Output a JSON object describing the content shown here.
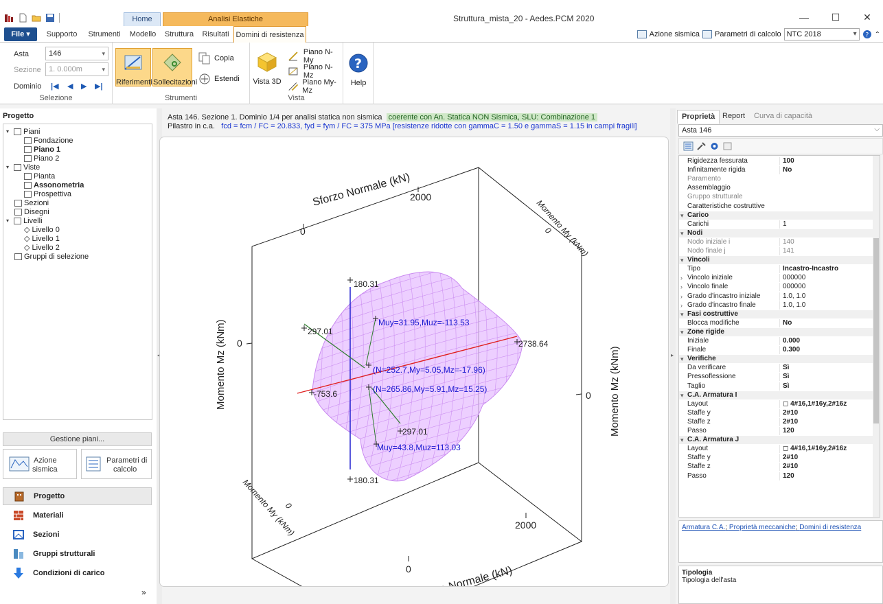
{
  "window": {
    "title": "Struttura_mista_20 - Aedes.PCM 2020",
    "context_home": "Home",
    "context_group": "Analisi Elastiche",
    "minimize": "—",
    "maximize": "☐",
    "close": "✕"
  },
  "tabs": {
    "file": "File ▾",
    "supporto": "Supporto",
    "strumenti": "Strumenti",
    "modello": "Modello",
    "struttura": "Struttura",
    "risultati": "Risultati",
    "domini": "Domini di resistenza"
  },
  "top_right": {
    "azione_sismica": "Azione sismica",
    "parametri_calcolo": "Parametri di calcolo",
    "norma": "NTC 2018"
  },
  "ribbon": {
    "selezione": {
      "label": "Selezione",
      "asta_label": "Asta",
      "asta_value": "146",
      "sezione_label": "Sezione",
      "sezione_value": "1. 0.000m",
      "dominio_label": "Dominio",
      "nav_first": "|◀",
      "nav_prev": "◀",
      "nav_next": "▶",
      "nav_last": "▶|"
    },
    "strumenti": {
      "label": "Strumenti",
      "riferimenti": "Riferimenti",
      "sollecitazioni": "Sollecitazioni",
      "copia": "Copia",
      "estendi": "Estendi"
    },
    "vista": {
      "label": "Vista",
      "vista3d": "Vista 3D",
      "piano_nmy": "Piano N-My",
      "piano_nmz": "Piano N-Mz",
      "piano_mymz": "Piano My-Mz"
    },
    "help": "Help"
  },
  "left": {
    "title": "Progetto",
    "tree": {
      "piani": "Piani",
      "fondazione": "Fondazione",
      "piano1": "Piano 1",
      "piano2": "Piano 2",
      "viste": "Viste",
      "pianta": "Pianta",
      "assonometria": "Assonometria",
      "prospettiva": "Prospettiva",
      "sezioni": "Sezioni",
      "disegni": "Disegni",
      "livelli": "Livelli",
      "livello0": "Livello 0",
      "livello1": "Livello 1",
      "livello2": "Livello 2",
      "gruppi": "Gruppi di selezione"
    },
    "gestione_piani": "Gestione piani...",
    "btn_azione_1": "Azione",
    "btn_azione_2": "sismica",
    "btn_param_1": "Parametri di",
    "btn_param_2": "calcolo",
    "nav": {
      "progetto": "Progetto",
      "materiali": "Materiali",
      "sezioni": "Sezioni",
      "gruppi": "Gruppi strutturali",
      "condizioni": "Condizioni di carico"
    },
    "more": "»"
  },
  "center": {
    "header1": "Asta 146. Sezione 1. Dominio 1/4 per analisi statica non sismica",
    "header1_badge": "coerente con An. Statica NON Sismica, SLU: Combinazione 1",
    "header2_label": "Pilastro in c.a.",
    "header2_values": "fcd = fcm  /  FC = 20.833, fyd = fym  /  FC = 375 MPa  [resistenze ridotte con gammaC = 1.50 e gammaS = 1.15 in campi fragili]"
  },
  "plot3d": {
    "axis_labels": {
      "n_top": "Sforzo Normale (kN)",
      "n_bottom": "Sforzo Normale (kN)",
      "my_top": "Momento My (kNm)",
      "my_bottom": "Momento My (kNm)",
      "mz_left": "Momento Mz (kNm)",
      "mz_right": "Momento Mz (kNm)"
    },
    "ticks": {
      "top_0": "0",
      "top_2000": "2000",
      "bottom_0": "0",
      "bottom_2000": "2000",
      "left_0": "0",
      "right_0": "0",
      "my_top_0": "0",
      "my_bottom_0": "0"
    },
    "points": {
      "p_top": "180.31",
      "p_bottom": "180.31",
      "p_left_top": "297.01",
      "p_left_bottom": "297.01",
      "p_right": "2738.64",
      "p_left": "-753.6",
      "p_muy_top": "Muy=31.95,Muz=-113.53",
      "p_muy_bottom": "Muy=43.8,Muz=113.03",
      "p_n1": "(N=252.7,My=5.05,Mz=-17.96)",
      "p_n2": "(N=265.86,My=5.91,Mz=15.25)"
    },
    "colors": {
      "domain_fill": "#e7bfff",
      "domain_mesh": "#c98af0",
      "n_axis": "#e02020",
      "mz_axis": "#2020d0",
      "my_axis": "#2e7d2e"
    }
  },
  "right": {
    "tab_proprieta": "Proprietà",
    "tab_report": "Report",
    "tab_curva": "Curva di capacità",
    "asta": "Asta 146",
    "rows": [
      {
        "n": "Rigidezza fessurata",
        "v": "100"
      },
      {
        "n": "Infinitamente rigida",
        "v": "No"
      },
      {
        "n": "Paramento",
        "v": ""
      },
      {
        "n": "Assemblaggio",
        "v": ""
      },
      {
        "n": "Gruppo strutturale",
        "v": ""
      },
      {
        "n": "Caratteristiche costruttive",
        "v": ""
      },
      {
        "n": "Carico",
        "v": ""
      },
      {
        "n": "Carichi",
        "v": "1"
      },
      {
        "n": "Nodi",
        "v": ""
      },
      {
        "n": "Nodo iniziale i",
        "v": "140"
      },
      {
        "n": "Nodo finale j",
        "v": "141"
      },
      {
        "n": "Vincoli",
        "v": ""
      },
      {
        "n": "Tipo",
        "v": "Incastro-Incastro"
      },
      {
        "n": "Vincolo iniziale",
        "v": "000000"
      },
      {
        "n": "Vincolo finale",
        "v": "000000"
      },
      {
        "n": "Grado d'incastro iniziale",
        "v": "1.0, 1.0"
      },
      {
        "n": "Grado d'incastro finale",
        "v": "1.0, 1.0"
      },
      {
        "n": "Fasi costruttive",
        "v": ""
      },
      {
        "n": "Blocca modifiche",
        "v": "No"
      },
      {
        "n": "Zone rigide",
        "v": ""
      },
      {
        "n": "Iniziale",
        "v": "0.000"
      },
      {
        "n": "Finale",
        "v": "0.300"
      },
      {
        "n": "Verifiche",
        "v": ""
      },
      {
        "n": "Da verificare",
        "v": "Sì"
      },
      {
        "n": "Pressoflessione",
        "v": "Sì"
      },
      {
        "n": "Taglio",
        "v": "Sì"
      },
      {
        "n": "C.A. Armatura I",
        "v": ""
      },
      {
        "n": "Layout",
        "v": "◻ 4#16,1#16y,2#16z"
      },
      {
        "n": "Staffe y",
        "v": "2#10"
      },
      {
        "n": "Staffe z",
        "v": "2#10"
      },
      {
        "n": "Passo",
        "v": "120"
      },
      {
        "n": "C.A. Armatura J",
        "v": ""
      },
      {
        "n": "Layout",
        "v": "◻ 4#16,1#16y,2#16z"
      },
      {
        "n": "Staffe y",
        "v": "2#10"
      },
      {
        "n": "Staffe z",
        "v": "2#10"
      },
      {
        "n": "Passo",
        "v": "120"
      }
    ],
    "links": {
      "a1": "Armatura C.A.",
      "a2": "Proprietà meccaniche",
      "a3": "Domini di resistenza"
    },
    "tipologia_title": "Tipologia",
    "tipologia_desc": "Tipologia dell'asta"
  }
}
